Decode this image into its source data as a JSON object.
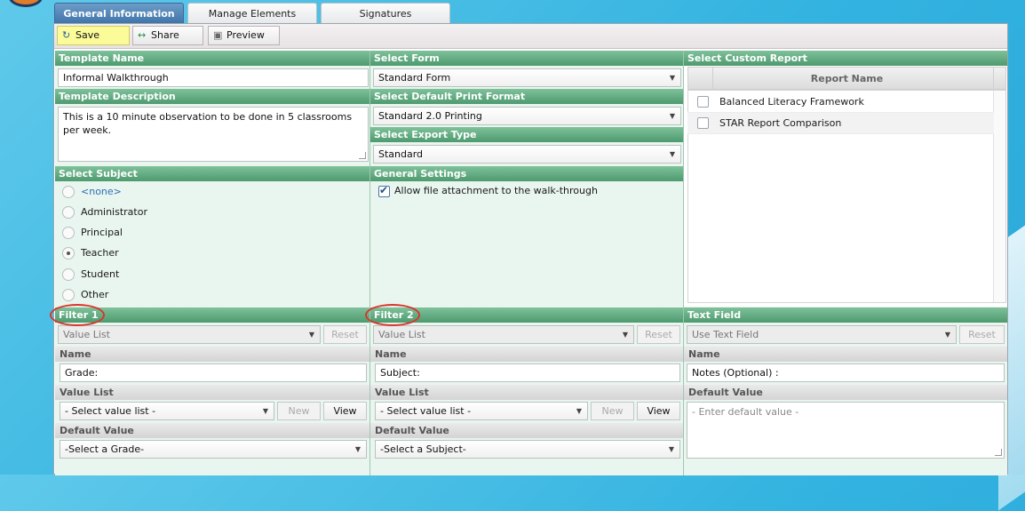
{
  "tabs": [
    {
      "label": "General Information",
      "active": true
    },
    {
      "label": "Manage Elements",
      "active": false
    },
    {
      "label": "Signatures",
      "active": false
    }
  ],
  "toolbar": {
    "save_label": "Save",
    "share_label": "Share",
    "preview_label": "Preview"
  },
  "template": {
    "name_header": "Template Name",
    "name_value": "Informal Walkthrough",
    "desc_header": "Template Description",
    "desc_value": "This is a 10 minute observation to be done in 5 classrooms per week."
  },
  "form": {
    "form_header": "Select Form",
    "form_value": "Standard Form",
    "print_header": "Select Default Print Format",
    "print_value": "Standard 2.0 Printing",
    "export_header": "Select Export Type",
    "export_value": "Standard"
  },
  "custom_report": {
    "header": "Select Custom Report",
    "column_header": "Report Name",
    "rows": [
      {
        "name": "Balanced Literacy Framework",
        "checked": false
      },
      {
        "name": "STAR Report Comparison",
        "checked": false
      }
    ]
  },
  "subject": {
    "header": "Select Subject",
    "options": [
      {
        "label": "<none>",
        "checked": false
      },
      {
        "label": "Administrator",
        "checked": false
      },
      {
        "label": "Principal",
        "checked": false
      },
      {
        "label": "Teacher",
        "checked": true
      },
      {
        "label": "Student",
        "checked": false
      },
      {
        "label": "Other",
        "checked": false
      }
    ]
  },
  "general_settings": {
    "header": "General Settings",
    "allow_attachment_label": "Allow file attachment to the walk-through",
    "allow_attachment_checked": true
  },
  "filter1": {
    "header": "Filter 1",
    "type_value": "Value List",
    "reset_label": "Reset",
    "name_header": "Name",
    "name_value": "Grade:",
    "value_list_header": "Value List",
    "value_list_value": "- Select value list -",
    "new_label": "New",
    "view_label": "View",
    "default_header": "Default Value",
    "default_value": "-Select a Grade-"
  },
  "filter2": {
    "header": "Filter 2",
    "type_value": "Value List",
    "reset_label": "Reset",
    "name_header": "Name",
    "name_value": "Subject:",
    "value_list_header": "Value List",
    "value_list_value": "- Select value list -",
    "new_label": "New",
    "view_label": "View",
    "default_header": "Default Value",
    "default_value": "-Select a Subject-"
  },
  "text_field": {
    "header": "Text Field",
    "type_value": "Use Text Field",
    "reset_label": "Reset",
    "name_header": "Name",
    "name_value": "Notes (Optional) :",
    "default_header": "Default Value",
    "default_placeholder": "- Enter default value -"
  },
  "colors": {
    "header_green": "#4e9a6f",
    "panel_bg": "#e9f5ef",
    "active_tab": "#3f73a8",
    "save_button": "#fbfb9a",
    "annotation_ring": "#d8372d"
  }
}
